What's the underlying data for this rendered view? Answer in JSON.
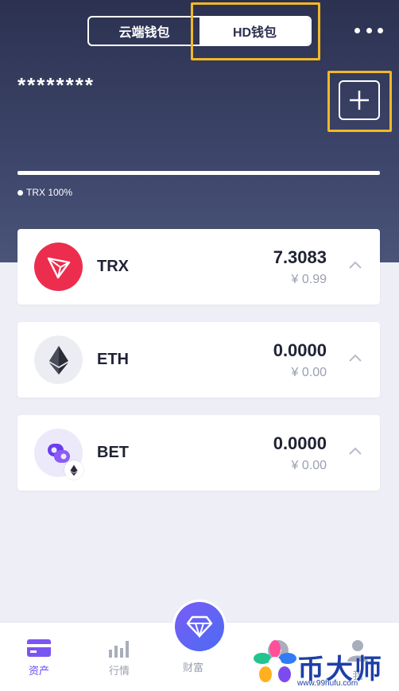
{
  "header": {
    "tabs": [
      {
        "label": "云端钱包",
        "active": false
      },
      {
        "label": "HD钱包",
        "active": true
      }
    ],
    "balance_mask": "********",
    "allocation_legend": "TRX 100%",
    "allocation": {
      "TRX": 1.0
    }
  },
  "assets": [
    {
      "symbol": "TRX",
      "amount": "7.3083",
      "fiat": "¥ 0.99",
      "icon": "tron-icon",
      "color": "#ec2d4e"
    },
    {
      "symbol": "ETH",
      "amount": "0.0000",
      "fiat": "¥ 0.00",
      "icon": "ethereum-icon",
      "color": "#ebedf2"
    },
    {
      "symbol": "BET",
      "amount": "0.0000",
      "fiat": "¥ 0.00",
      "icon": "bet-token-icon",
      "color": "#ece9fb"
    }
  ],
  "tabbar": {
    "items": [
      {
        "label": "资产",
        "icon": "wallet-card-icon",
        "active": true
      },
      {
        "label": "行情",
        "icon": "market-bars-icon",
        "active": false
      },
      {
        "label": "财富",
        "icon": "diamond-icon",
        "active": false
      },
      {
        "label": "",
        "icon": "discover-icon",
        "active": false
      },
      {
        "label": "我",
        "icon": "profile-icon",
        "active": false
      }
    ]
  },
  "watermark": {
    "title": "币大师",
    "url": "www.99hufu.com"
  },
  "colors": {
    "accent": "#6a4cf0",
    "highlight": "#f2b825",
    "header": "#2c3150"
  }
}
